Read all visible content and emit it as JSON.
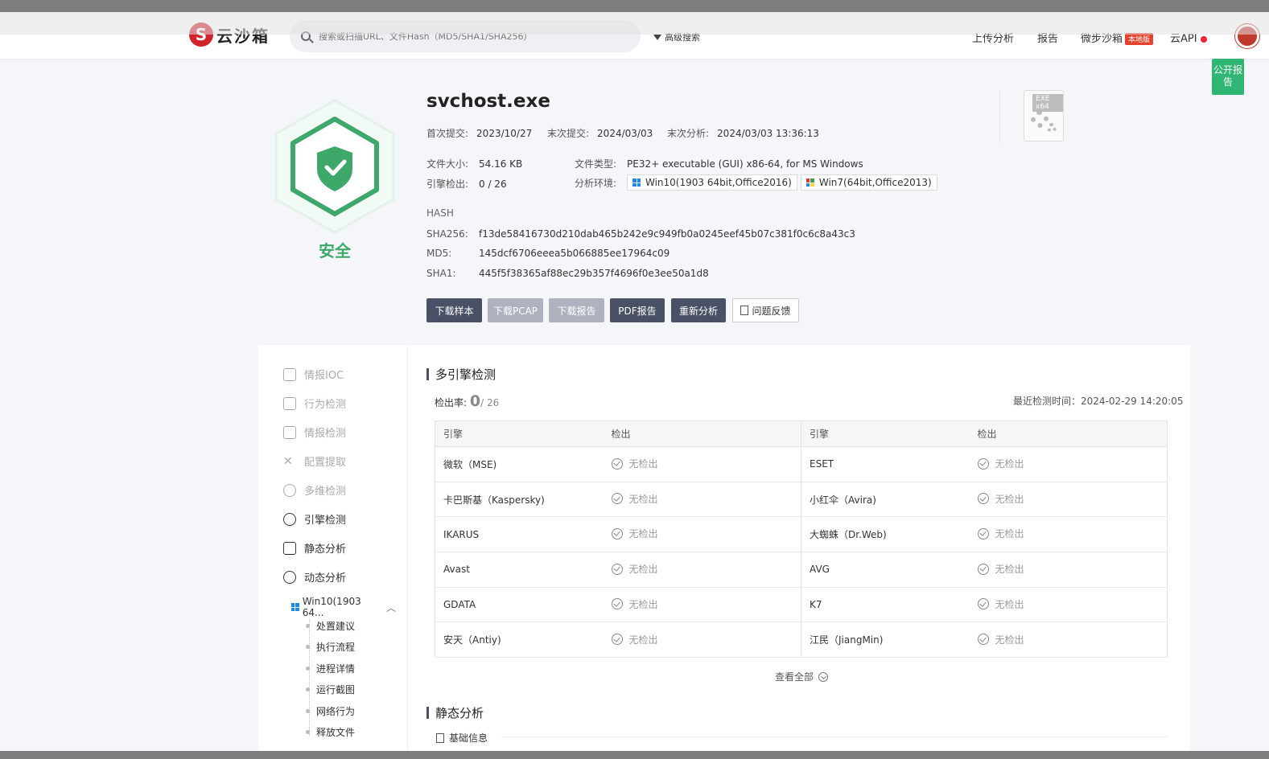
{
  "header": {
    "logo_text": "云沙箱",
    "logo_mark": "S",
    "search_placeholder": "搜索或扫描URL、文件Hash（MD5/SHA1/SHA256）",
    "adv_search": "高级搜索",
    "nav": {
      "upload": "上传分析",
      "report": "报告",
      "weibu": "微步沙箱",
      "weibu_badge": "本地版",
      "api": "云API"
    },
    "public_report": "公开报告"
  },
  "summary": {
    "status": "安全",
    "file_name": "svchost.exe",
    "first_submit_label": "首次提交:",
    "first_submit": "2023/10/27",
    "last_submit_label": "末次提交:",
    "last_submit": "2024/03/03",
    "last_analysis_label": "末次分析:",
    "last_analysis": "2024/03/03 13:36:13",
    "size_label": "文件大小:",
    "size": "54.16 KB",
    "type_label": "文件类型:",
    "type": "PE32+ executable (GUI) x86-64, for MS Windows",
    "engines_label": "引擎检出:",
    "engines": "0 / 26",
    "env_label": "分析环境:",
    "env1": "Win10(1903 64bit,Office2016)",
    "env2": "Win7(64bit,Office2013)",
    "hash_label": "HASH",
    "sha256_label": "SHA256:",
    "sha256": "f13de58416730d210dab465b242e9c949fb0a0245eef45b07c381f0c6c8a43c3",
    "md5_label": "MD5:",
    "md5": "145dcf6706eeea5b066885ee17964c09",
    "sha1_label": "SHA1:",
    "sha1": "445f5f38365af88ec29b357f4696f0e3ee50a1d8",
    "file_icon_tag": "EXE x64"
  },
  "buttons": {
    "download_sample": "下载样本",
    "download_pcap": "下载PCAP",
    "download_report": "下载报告",
    "pdf_report": "PDF报告",
    "reanalyze": "重新分析",
    "feedback": "问题反馈"
  },
  "sidebar": {
    "items": [
      "情报IOC",
      "行为检测",
      "情报检测",
      "配置提取",
      "多维检测",
      "引擎检测",
      "静态分析",
      "动态分析"
    ],
    "env": "Win10(1903 64...",
    "sub_items": [
      "处置建议",
      "执行流程",
      "进程详情",
      "运行截图",
      "网络行为",
      "释放文件"
    ]
  },
  "engine_section": {
    "title": "多引擎检测",
    "rate_label": "检出率:",
    "rate_value": "0",
    "rate_total": "/ 26",
    "last_time": "最近检测时间：2024-02-29 14:20:05",
    "col_engine": "引擎",
    "col_detect": "检出",
    "rows": [
      {
        "l": "微软（MSE)",
        "r": "ESET"
      },
      {
        "l": "卡巴斯基（Kaspersky)",
        "r": "小红伞（Avira)"
      },
      {
        "l": "IKARUS",
        "r": "大蜘蛛（Dr.Web)"
      },
      {
        "l": "Avast",
        "r": "AVG"
      },
      {
        "l": "GDATA",
        "r": "K7"
      },
      {
        "l": "安天（Antiy)",
        "r": "江民（JiangMin)"
      }
    ],
    "no_detect": "无检出",
    "view_all": "查看全部"
  },
  "static_section": {
    "title": "静态分析",
    "basic_info": "基础信息"
  },
  "colors": {
    "safe_green": "#3ea86a",
    "dark_button": "#4a5066",
    "public_report": "#2eb672"
  }
}
